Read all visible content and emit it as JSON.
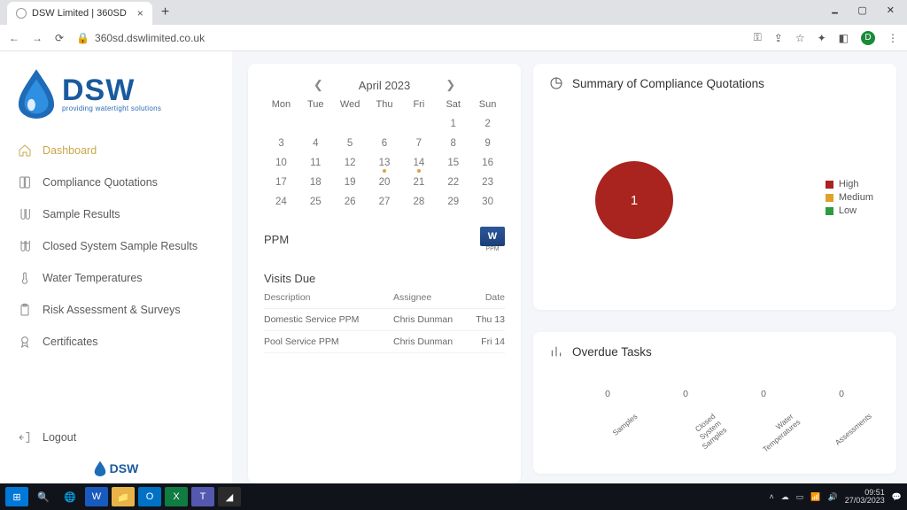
{
  "browser": {
    "tab_title": "DSW Limited | 360SD",
    "url": "360sd.dswlimited.co.uk",
    "avatar_letter": "D"
  },
  "logo": {
    "main": "DSW",
    "sub": "providing watertight solutions",
    "mini": "DSW"
  },
  "nav": {
    "items": [
      {
        "label": "Dashboard"
      },
      {
        "label": "Compliance Quotations"
      },
      {
        "label": "Sample Results"
      },
      {
        "label": "Closed System Sample Results"
      },
      {
        "label": "Water Temperatures"
      },
      {
        "label": "Risk Assessment & Surveys"
      },
      {
        "label": "Certificates"
      }
    ],
    "logout": "Logout"
  },
  "calendar": {
    "month_label": "April 2023",
    "dow": [
      "Mon",
      "Tue",
      "Wed",
      "Thu",
      "Fri",
      "Sat",
      "Sun"
    ],
    "rows": [
      [
        "",
        "",
        "",
        "",
        "",
        "1",
        "2"
      ],
      [
        "3",
        "4",
        "5",
        "6",
        "7",
        "8",
        "9"
      ],
      [
        "10",
        "11",
        "12",
        "13",
        "14",
        "15",
        "16"
      ],
      [
        "17",
        "18",
        "19",
        "20",
        "21",
        "22",
        "23"
      ],
      [
        "24",
        "25",
        "26",
        "27",
        "28",
        "29",
        "30"
      ]
    ],
    "dots": [
      "13",
      "14"
    ]
  },
  "ppm": {
    "title": "PPM",
    "doc_letter": "W",
    "doc_caption": "PPM"
  },
  "visits": {
    "title": "Visits Due",
    "cols": [
      "Description",
      "Assignee",
      "Date"
    ],
    "rows": [
      {
        "desc": "Domestic Service PPM",
        "assignee": "Chris Dunman",
        "date": "Thu 13"
      },
      {
        "desc": "Pool Service PPM",
        "assignee": "Chris Dunman",
        "date": "Fri 14"
      }
    ]
  },
  "summary": {
    "title": "Summary of Compliance Quotations",
    "legend": [
      {
        "label": "High",
        "color": "#a9231f"
      },
      {
        "label": "Medium",
        "color": "#e0a12a"
      },
      {
        "label": "Low",
        "color": "#2e9c3e"
      }
    ]
  },
  "overdue": {
    "title": "Overdue Tasks",
    "bars": [
      {
        "label": "Samples",
        "value": 0
      },
      {
        "label": "Closed\nSystem\nSamples",
        "value": 0
      },
      {
        "label": "Water\nTemperatures",
        "value": 0
      },
      {
        "label": "Assessments",
        "value": 0
      }
    ]
  },
  "chart_data": [
    {
      "type": "pie",
      "title": "Summary of Compliance Quotations",
      "series": [
        {
          "name": "High",
          "value": 1,
          "color": "#a9231f"
        },
        {
          "name": "Medium",
          "value": 0,
          "color": "#e0a12a"
        },
        {
          "name": "Low",
          "value": 0,
          "color": "#2e9c3e"
        }
      ],
      "center_label": "1"
    },
    {
      "type": "bar",
      "title": "Overdue Tasks",
      "categories": [
        "Samples",
        "Closed System Samples",
        "Water Temperatures",
        "Assessments"
      ],
      "values": [
        0,
        0,
        0,
        0
      ],
      "ylim": [
        0,
        1
      ]
    }
  ],
  "taskbar": {
    "time": "09:51",
    "date": "27/03/2023"
  }
}
